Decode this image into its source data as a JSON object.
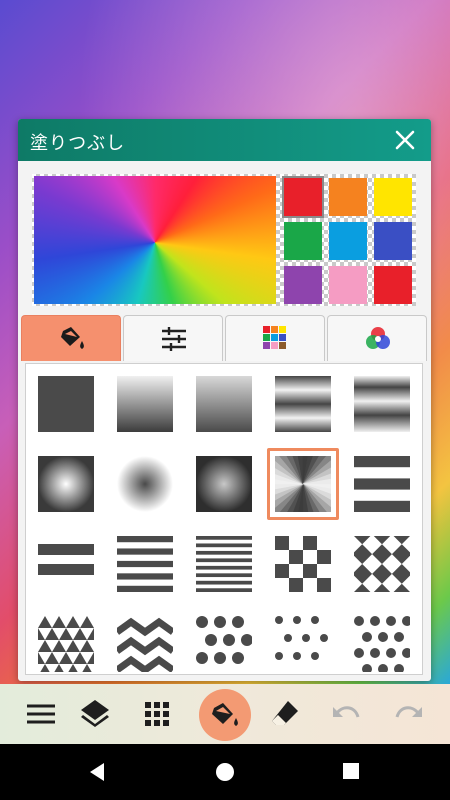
{
  "dialog": {
    "title": "塗りつぶし",
    "current_fill": "rainbow-conical-gradient",
    "swatches": [
      {
        "color": "#e8202a",
        "selected": true
      },
      {
        "color": "#f5821f"
      },
      {
        "color": "#ffe500"
      },
      {
        "color": "#1aa748"
      },
      {
        "color": "#0a9ee0"
      },
      {
        "color": "#3a4fc4"
      },
      {
        "color": "#8e44ad"
      },
      {
        "color": "#f59cc3"
      },
      {
        "color": "#e8202a"
      }
    ],
    "tabs": [
      {
        "icon": "paint-bucket-icon",
        "active": true
      },
      {
        "icon": "sliders-icon"
      },
      {
        "icon": "color-grid-icon"
      },
      {
        "icon": "rgb-circles-icon"
      }
    ],
    "patterns": [
      "solid",
      "linear-vertical",
      "linear-vertical-2",
      "horizontal-bands",
      "horizontal-bands-2",
      "radial-light",
      "radial-soft",
      "radial-dark",
      "conical",
      "wide-stripes",
      "stripes-2",
      "stripes-4",
      "stripes-6",
      "checker",
      "diamond-checker",
      "triangles",
      "zigzag",
      "large-dots",
      "small-dots",
      "mixed-dots"
    ],
    "selected_pattern": "conical"
  },
  "toolbar": {
    "tools": [
      "menu-icon",
      "layers-icon",
      "grid-icon",
      "paint-bucket-icon",
      "eraser-icon",
      "undo-icon",
      "redo-icon"
    ],
    "active": "paint-bucket-icon"
  },
  "navbar": [
    "back-icon",
    "home-icon",
    "recents-icon"
  ],
  "colors": {
    "accent": "#f39a73",
    "title_bar": "#0e8a74",
    "pattern_ink": "#4a4a4a"
  }
}
